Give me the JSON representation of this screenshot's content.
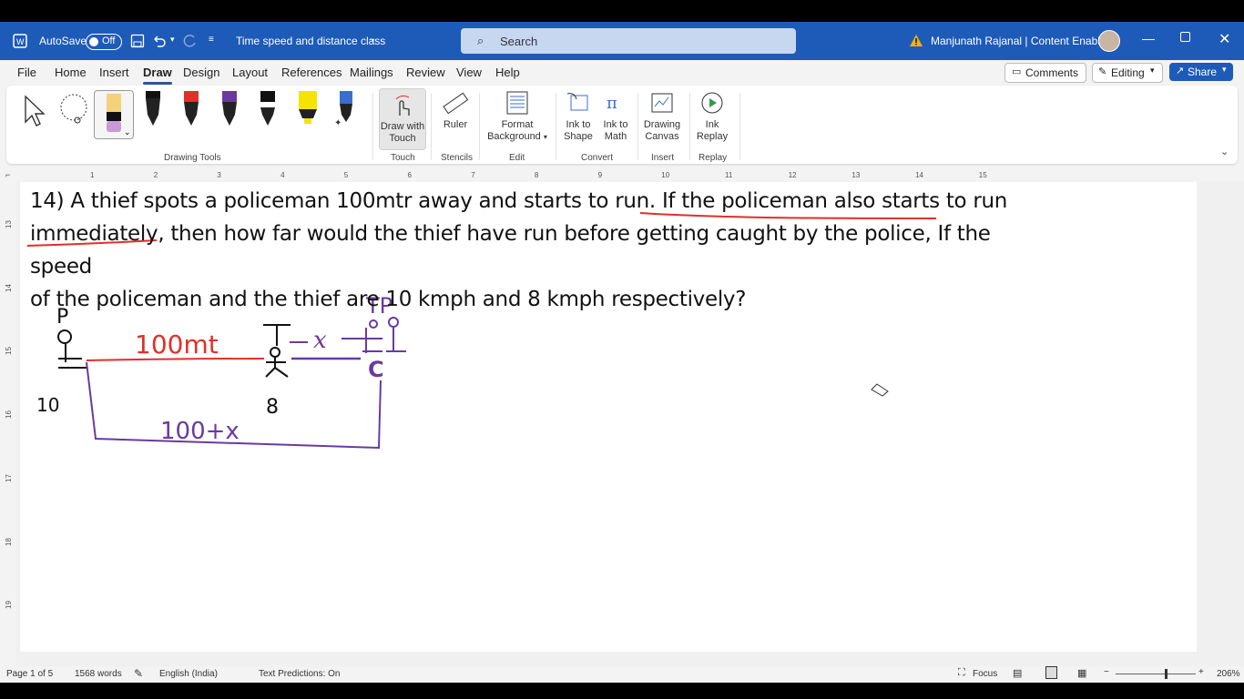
{
  "titlebar": {
    "autosave_label": "AutoSave",
    "autosave_state": "Off",
    "doc_title": "Time speed and distance class",
    "search_placeholder": "Search",
    "user_name": "Manjunath Rajanal | Content Enablers"
  },
  "tabs": [
    "File",
    "Home",
    "Insert",
    "Draw",
    "Design",
    "Layout",
    "References",
    "Mailings",
    "Review",
    "View",
    "Help"
  ],
  "active_tab": "Draw",
  "ribbon_right": {
    "comments": "Comments",
    "editing": "Editing",
    "share": "Share"
  },
  "ribbon": {
    "groups": {
      "drawing_tools": "Drawing Tools",
      "touch": "Touch",
      "stencils": "Stencils",
      "edit": "Edit",
      "convert": "Convert",
      "insert": "Insert",
      "replay": "Replay"
    },
    "buttons": {
      "draw_touch_1": "Draw with",
      "draw_touch_2": "Touch",
      "ruler": "Ruler",
      "format_bg_1": "Format",
      "format_bg_2": "Background",
      "ink_shape_1": "Ink to",
      "ink_shape_2": "Shape",
      "ink_math_1": "Ink to",
      "ink_math_2": "Math",
      "canvas_1": "Drawing",
      "canvas_2": "Canvas",
      "replay_1": "Ink",
      "replay_2": "Replay"
    }
  },
  "ruler_numbers": [
    "1",
    "2",
    "3",
    "4",
    "5",
    "6",
    "7",
    "8",
    "9",
    "10",
    "11",
    "12",
    "13",
    "14",
    "15"
  ],
  "vruler_numbers": [
    "13",
    "14",
    "15",
    "16",
    "17",
    "18",
    "19"
  ],
  "question": {
    "line1_a": "14) A thief spots a policeman 100mtr away and starts to run. ",
    "line1_b": "If the policeman also starts to run",
    "line2_a": "immediately",
    "line2_b": ", then how far would the thief have run before getting caught by the police, If the speed",
    "line3": "of the policeman and the thief are 10 kmph and 8 kmph respectively?"
  },
  "ink": {
    "p_label": "P",
    "p_speed": "10",
    "dist": "100mt",
    "t_label": "T",
    "x_label": "x",
    "t_speed": "8",
    "tp_label": "TP",
    "c_label": "C",
    "total": "100+x",
    "colors": {
      "black": "#111111",
      "red": "#e0302a",
      "purple": "#6a3aa0"
    }
  },
  "status": {
    "page": "Page 1 of 5",
    "words": "1568 words",
    "language": "English (India)",
    "predictions": "Text Predictions: On",
    "focus": "Focus",
    "zoom": "206%"
  }
}
